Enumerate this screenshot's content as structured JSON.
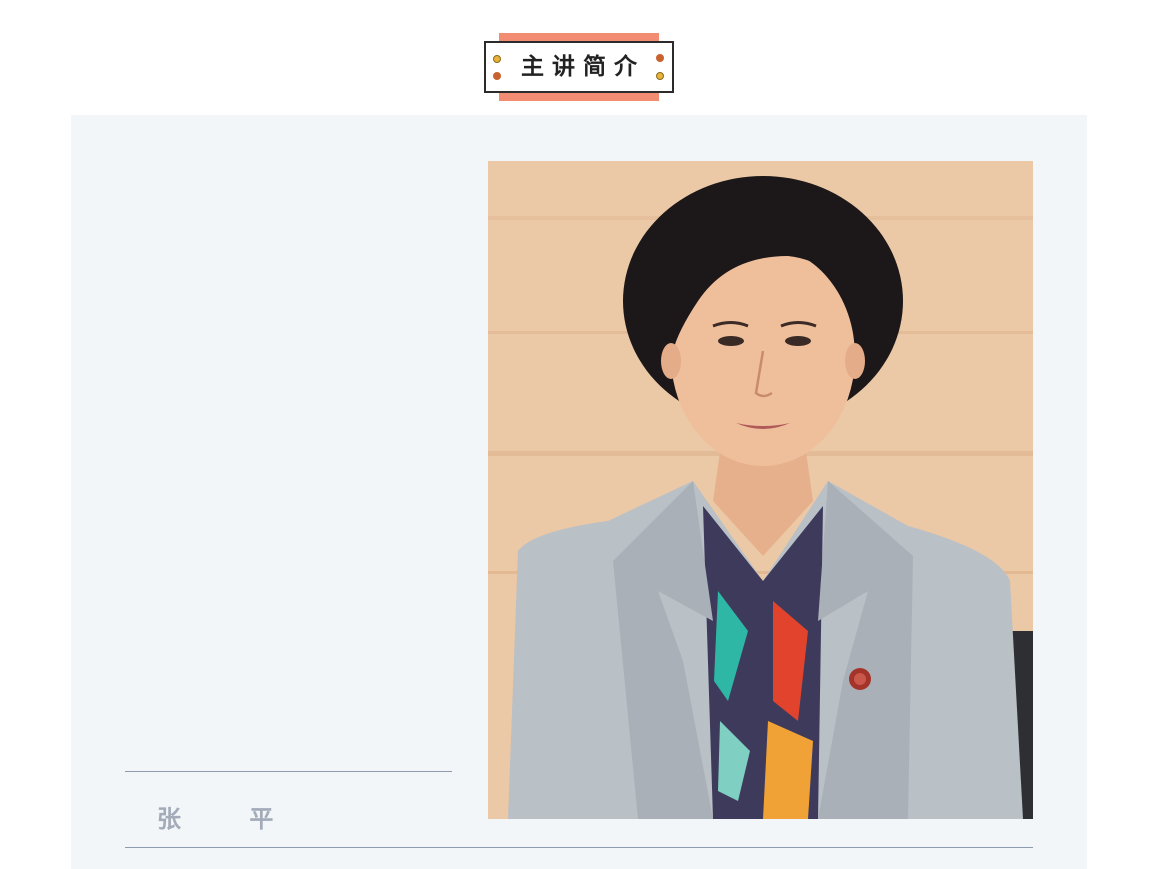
{
  "section": {
    "title": "主讲简介"
  },
  "speaker": {
    "name": "张 平"
  },
  "colors": {
    "accent": "#f28d74",
    "card_background": "#f3f6f9",
    "name_text": "#a3abb8",
    "rule": "#8e9bad"
  },
  "icons": [
    "decorative-dot-icon"
  ]
}
